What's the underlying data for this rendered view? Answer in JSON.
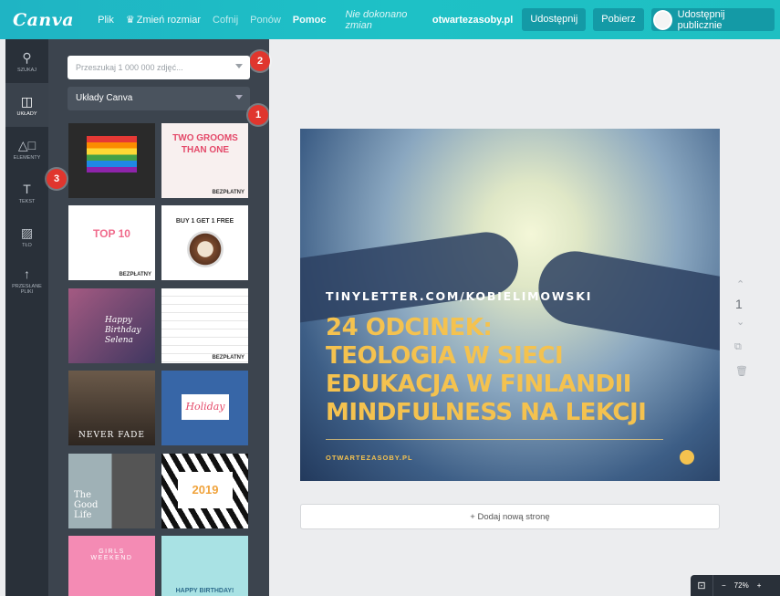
{
  "app": {
    "logo": "Canva"
  },
  "menu": {
    "file": "Plik",
    "resize": "Zmień rozmiar",
    "undo": "Cofnij",
    "redo": "Ponów",
    "help": "Pomoc",
    "status": "Nie dokonano zmian"
  },
  "topbar_right": {
    "domain": "otwartezasoby.pl",
    "share": "Udostępnij",
    "download": "Pobierz",
    "publish": "Udostępnij publicznie"
  },
  "rail": [
    {
      "label": "SZUKAJ",
      "icon": "search-icon",
      "glyph": "⚲"
    },
    {
      "label": "UKŁADY",
      "icon": "layouts-icon",
      "glyph": "◫"
    },
    {
      "label": "ELEMENTY",
      "icon": "elements-icon",
      "glyph": "△□"
    },
    {
      "label": "TEKST",
      "icon": "text-icon",
      "glyph": "T"
    },
    {
      "label": "TŁO",
      "icon": "background-icon",
      "glyph": "▨"
    },
    {
      "label": "PRZESŁANE PLIKI",
      "icon": "upload-icon",
      "glyph": "↑"
    }
  ],
  "panel": {
    "search_placeholder": "Przeszukaj 1 000 000 zdjęć...",
    "layouts_select": "Układy Canva"
  },
  "badges": [
    "1",
    "2",
    "3"
  ],
  "thumbnails": [
    {
      "title": "",
      "free": "",
      "bg": "#2a2a2a"
    },
    {
      "title": "TWO GROOMS THAN ONE",
      "free": "BEZPŁATNY",
      "bg": "#f8f0ef"
    },
    {
      "title": "TOP 10",
      "free": "BEZPŁATNY",
      "bg": "#ffffff"
    },
    {
      "title": "BUY 1 GET 1 FREE",
      "free": "",
      "bg": "#ffffff"
    },
    {
      "title": "Happy Birthday Selena",
      "free": "",
      "bg": "#6c4a7a"
    },
    {
      "title": "",
      "free": "BEZPŁATNY",
      "bg": "#ffffff"
    },
    {
      "title": "NEVER FADE",
      "free": "",
      "bg": "#4a3c30"
    },
    {
      "title": "Holiday",
      "free": "",
      "bg": "#3766a7"
    },
    {
      "title": "The Good Life",
      "free": "",
      "bg": "#9fb1b6"
    },
    {
      "title": "2019",
      "free": "",
      "bg": "#ffffff"
    },
    {
      "title": "GIRLS WEEKEND",
      "free": "",
      "bg": "#f48bb4"
    },
    {
      "title": "HAPPY BIRTHDAY!",
      "free": "",
      "bg": "#a9e2e4"
    }
  ],
  "design": {
    "url": "TINYLETTER.COM/KOBIELIMOWSKI",
    "line1": "24 ODCINEK:",
    "line2": "TEOLOGIA W SIECI",
    "line3": "EDUKACJA W FINLANDII",
    "line4": "MINDFULNESS NA LEKCJI",
    "footer": "OTWARTEZASOBY.PL"
  },
  "page_number": "1",
  "add_page": "+ Dodaj nową stronę",
  "zoom": {
    "minus": "−",
    "level": "72%",
    "plus": "+"
  }
}
